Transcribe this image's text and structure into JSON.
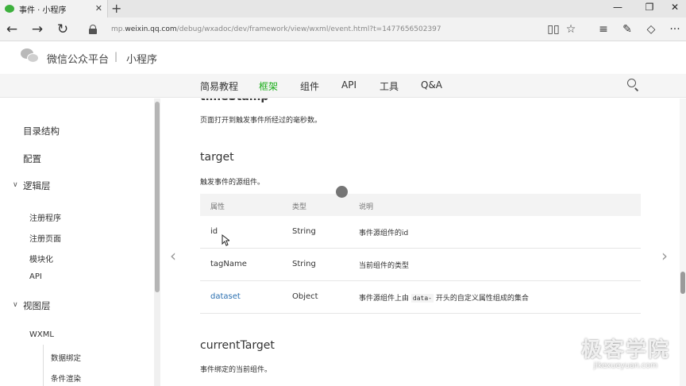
{
  "browser": {
    "tab_title": "事件 · 小程序",
    "tab_close": "✕",
    "new_tab": "+",
    "url_prefix": "mp.",
    "url_host": "weixin.qq.com",
    "url_path": "/debug/wxadoc/dev/framework/view/wxml/event.html?t=1477656502397",
    "icons": [
      "back-icon",
      "forward-icon",
      "refresh-icon",
      "lock-icon",
      "reading-view-icon",
      "star-icon",
      "hub-icon",
      "note-icon",
      "share-icon",
      "more-icon"
    ]
  },
  "header": {
    "brand": "微信公众平台",
    "separator": "|",
    "sub": "小程序"
  },
  "nav": {
    "items": [
      "简易教程",
      "框架",
      "组件",
      "API",
      "工具",
      "Q&A"
    ],
    "active": "框架"
  },
  "sidebar": {
    "items": {
      "directory": "目录结构",
      "config": "配置",
      "logic": "逻辑层",
      "register_app": "注册程序",
      "register_page": "注册页面",
      "modular": "模块化",
      "api": "API",
      "view": "视图层",
      "wxml": "WXML",
      "data_binding": "数据绑定",
      "conditional": "条件渲染"
    }
  },
  "content": {
    "prev_heading": "timeStamp",
    "prev_desc": "页面打开到触发事件所经过的毫秒数。",
    "target_heading": "target",
    "target_desc": "触发事件的源组件。",
    "table": {
      "headers": [
        "属性",
        "类型",
        "说明"
      ],
      "rows": [
        {
          "name": "id",
          "type": "String",
          "desc": "事件源组件的id"
        },
        {
          "name": "tagName",
          "type": "String",
          "desc": "当前组件的类型"
        },
        {
          "name": "dataset",
          "type": "Object",
          "desc_before": "事件源组件上由",
          "desc_code": "data-",
          "desc_after": "开头的自定义属性组成的集合"
        }
      ]
    },
    "current_heading": "currentTarget",
    "current_desc": "事件绑定的当前组件。"
  },
  "watermark": {
    "big": "极客学院",
    "small": "jikexueyuan.com"
  },
  "colors": {
    "accent": "#1aad19",
    "link": "#2a6fb0"
  }
}
